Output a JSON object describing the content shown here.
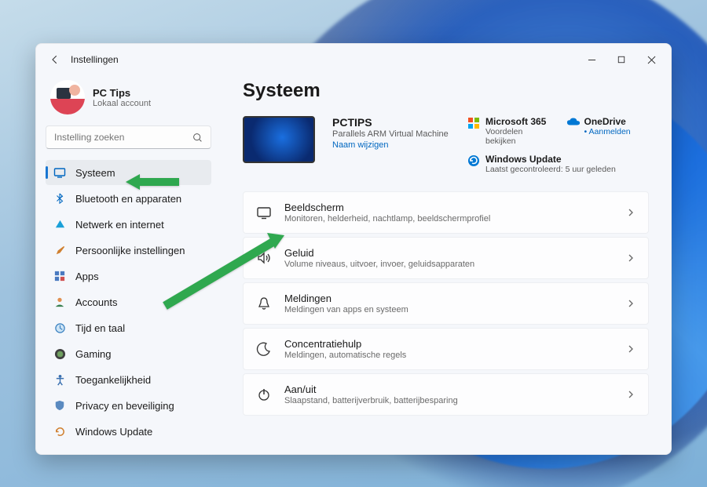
{
  "window": {
    "title": "Instellingen"
  },
  "profile": {
    "name": "PC Tips",
    "sub": "Lokaal account"
  },
  "search": {
    "placeholder": "Instelling zoeken"
  },
  "nav": {
    "items": [
      {
        "label": "Systeem",
        "icon": "system"
      },
      {
        "label": "Bluetooth en apparaten",
        "icon": "bluetooth"
      },
      {
        "label": "Netwerk en internet",
        "icon": "wifi"
      },
      {
        "label": "Persoonlijke instellingen",
        "icon": "personalize"
      },
      {
        "label": "Apps",
        "icon": "apps"
      },
      {
        "label": "Accounts",
        "icon": "accounts"
      },
      {
        "label": "Tijd en taal",
        "icon": "time"
      },
      {
        "label": "Gaming",
        "icon": "gaming"
      },
      {
        "label": "Toegankelijkheid",
        "icon": "accessibility"
      },
      {
        "label": "Privacy en beveiliging",
        "icon": "privacy"
      },
      {
        "label": "Windows Update",
        "icon": "update"
      }
    ]
  },
  "page": {
    "title": "Systeem"
  },
  "pc": {
    "name": "PCTIPS",
    "model": "Parallels ARM Virtual Machine",
    "rename": "Naam wijzigen"
  },
  "cards": {
    "ms365": {
      "title": "Microsoft 365",
      "sub": "Voordelen bekijken"
    },
    "onedrive": {
      "title": "OneDrive",
      "sub": "Aanmelden"
    },
    "update": {
      "title": "Windows Update",
      "sub": "Laatst gecontroleerd: 5 uur geleden"
    }
  },
  "settings": [
    {
      "title": "Beeldscherm",
      "sub": "Monitoren, helderheid, nachtlamp, beeldschermprofiel",
      "icon": "display"
    },
    {
      "title": "Geluid",
      "sub": "Volume niveaus, uitvoer, invoer, geluidsapparaten",
      "icon": "sound"
    },
    {
      "title": "Meldingen",
      "sub": "Meldingen van apps en systeem",
      "icon": "bell"
    },
    {
      "title": "Concentratiehulp",
      "sub": "Meldingen, automatische regels",
      "icon": "moon"
    },
    {
      "title": "Aan/uit",
      "sub": "Slaapstand, batterijverbruik, batterijbesparing",
      "icon": "power"
    }
  ],
  "colors": {
    "accent": "#0067c0",
    "arrow": "#2fa84f"
  }
}
